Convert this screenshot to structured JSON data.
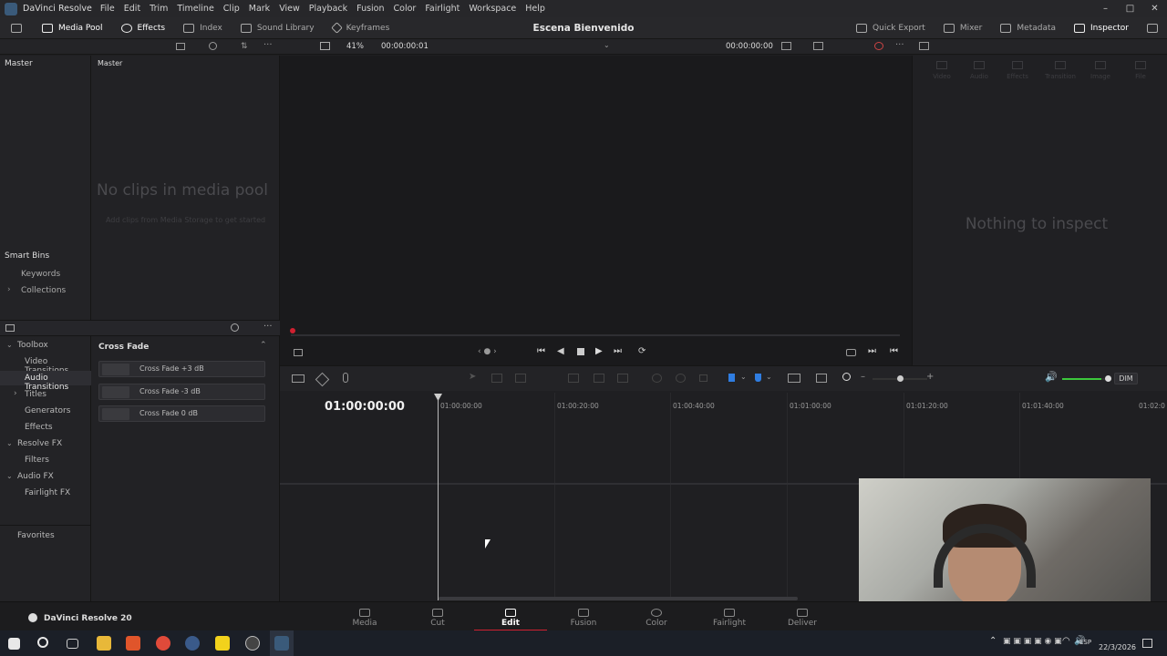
{
  "app": {
    "title": "DaVinci Resolve",
    "version_label": "DaVinci Resolve 20"
  },
  "menu": [
    "File",
    "Edit",
    "Trim",
    "Timeline",
    "Clip",
    "Mark",
    "View",
    "Playback",
    "Fusion",
    "Color",
    "Fairlight",
    "Workspace",
    "Help"
  ],
  "toolbar": {
    "left": [
      {
        "label": "Media Pool",
        "icon": "media-pool-icon",
        "active": true
      },
      {
        "label": "Effects",
        "icon": "effects-icon",
        "active": true
      },
      {
        "label": "Index",
        "icon": "index-icon",
        "active": false
      },
      {
        "label": "Sound Library",
        "icon": "sound-library-icon",
        "active": false
      },
      {
        "label": "Keyframes",
        "icon": "keyframes-icon",
        "active": false
      }
    ],
    "project_title": "Escena Bienvenido",
    "right": [
      {
        "label": "Quick Export",
        "icon": "export-icon"
      },
      {
        "label": "Mixer",
        "icon": "mixer-icon"
      },
      {
        "label": "Metadata",
        "icon": "metadata-icon"
      },
      {
        "label": "Inspector",
        "icon": "inspector-icon"
      }
    ]
  },
  "viewer": {
    "zoom": "41%",
    "source_timecode": "00:00:00:01",
    "record_timecode": "00:00:00:00"
  },
  "bins": {
    "master_left": "Master",
    "master_right": "Master",
    "smart_bins": "Smart Bins",
    "keywords": "Keywords",
    "collections": "Collections"
  },
  "media_pool": {
    "empty_title": "No clips in media pool",
    "empty_hint": "Add clips from Media Storage to get started"
  },
  "inspector": {
    "tabs": [
      "Video",
      "Audio",
      "Effects",
      "Transition",
      "Image",
      "File"
    ],
    "empty": "Nothing to inspect"
  },
  "effects_tree": {
    "toolbox": "Toolbox",
    "video_transitions": "Video Transitions",
    "audio_transitions": "Audio Transitions",
    "titles": "Titles",
    "generators": "Generators",
    "effects": "Effects",
    "resolve_fx": "Resolve FX",
    "filters": "Filters",
    "audio_fx": "Audio FX",
    "fairlight_fx": "Fairlight FX",
    "favorites": "Favorites"
  },
  "effects_list": {
    "group": "Cross Fade",
    "items": [
      "Cross Fade +3 dB",
      "Cross Fade -3 dB",
      "Cross Fade 0 dB"
    ]
  },
  "timeline": {
    "timecode": "01:00:00:00",
    "ruler": [
      "01:00:00:00",
      "01:00:20:00",
      "01:00:40:00",
      "01:01:00:00",
      "01:01:20:00",
      "01:01:40:00",
      "01:02:0"
    ],
    "dim_label": "DIM",
    "volume": 0.85
  },
  "pages": [
    {
      "label": "Media",
      "icon": "media-page-icon"
    },
    {
      "label": "Cut",
      "icon": "cut-page-icon"
    },
    {
      "label": "Edit",
      "icon": "edit-page-icon",
      "active": true
    },
    {
      "label": "Fusion",
      "icon": "fusion-page-icon"
    },
    {
      "label": "Color",
      "icon": "color-page-icon"
    },
    {
      "label": "Fairlight",
      "icon": "fairlight-page-icon"
    },
    {
      "label": "Deliver",
      "icon": "deliver-page-icon"
    }
  ],
  "taskbar": {
    "language": "ESP",
    "date": "22/3/2026"
  },
  "colors": {
    "accent": "#d02030",
    "clip_marker": "#2f7de1",
    "volume": "#3cc83c"
  }
}
